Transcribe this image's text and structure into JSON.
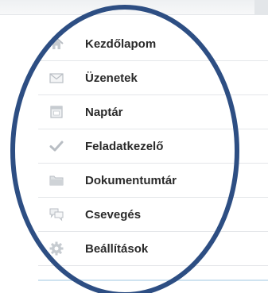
{
  "nav": {
    "items": [
      {
        "label": "Kezdőlapom",
        "icon": "home-icon"
      },
      {
        "label": "Üzenetek",
        "icon": "envelope-icon"
      },
      {
        "label": "Naptár",
        "icon": "calendar-icon"
      },
      {
        "label": "Feladatkezelő",
        "icon": "checkmark-icon"
      },
      {
        "label": "Dokumentumtár",
        "icon": "folder-icon"
      },
      {
        "label": "Csevegés",
        "icon": "chat-bubbles-icon"
      },
      {
        "label": "Beállítások",
        "icon": "gear-icon"
      }
    ]
  },
  "annotation": {
    "shape": "ellipse",
    "color": "#2d4e83"
  },
  "colors": {
    "label_text": "#2a2a2a",
    "icon_gray": "#b9bec4",
    "divider": "#e4e6e9"
  }
}
